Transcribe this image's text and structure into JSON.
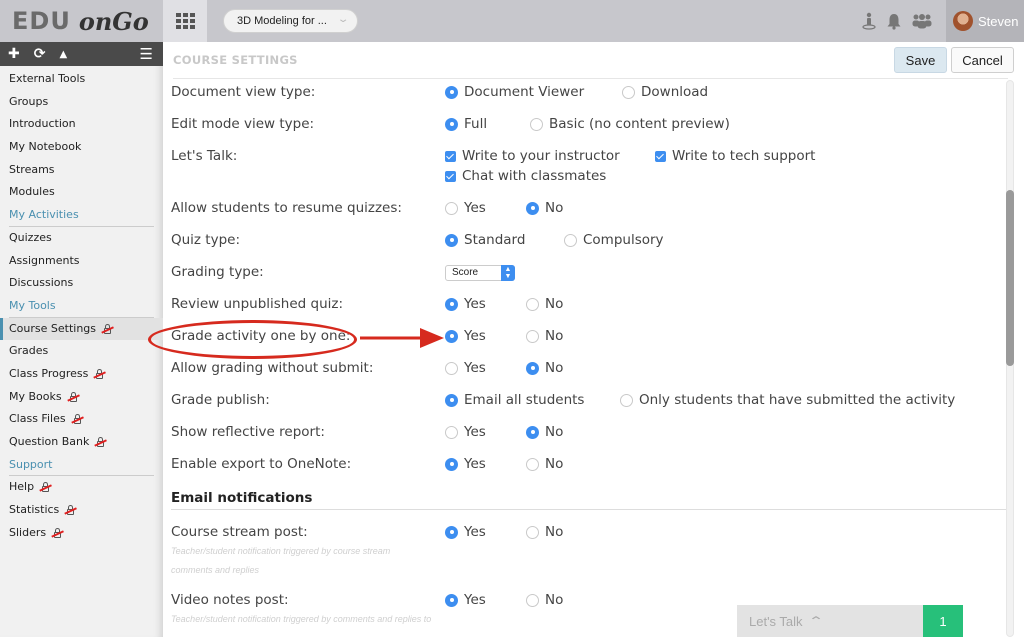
{
  "header": {
    "logo_part1": "EDU",
    "logo_part2": "onGo",
    "course_selector": "3D Modeling for ...",
    "user_name": "Steven",
    "icons": [
      "person-pin-icon",
      "bell-icon",
      "users-icon"
    ]
  },
  "sidebar": {
    "toolbar_icons": [
      "plus-icon",
      "refresh-icon",
      "sort-icon",
      "menu-icon"
    ],
    "items": [
      {
        "label": "External Tools",
        "type": "item",
        "locked": false
      },
      {
        "label": "Groups",
        "type": "item",
        "locked": false
      },
      {
        "label": "Introduction",
        "type": "item",
        "locked": false
      },
      {
        "label": "My Notebook",
        "type": "item",
        "locked": false
      },
      {
        "label": "Streams",
        "type": "item",
        "locked": false
      },
      {
        "label": "Modules",
        "type": "item",
        "locked": false
      },
      {
        "label": "My Activities",
        "type": "section",
        "locked": false
      },
      {
        "label": "Quizzes",
        "type": "item",
        "locked": false
      },
      {
        "label": "Assignments",
        "type": "item",
        "locked": false
      },
      {
        "label": "Discussions",
        "type": "item",
        "locked": false
      },
      {
        "label": "My Tools",
        "type": "section",
        "locked": false
      },
      {
        "label": "Course Settings",
        "type": "item",
        "locked": true,
        "active": true
      },
      {
        "label": "Grades",
        "type": "item",
        "locked": false
      },
      {
        "label": "Class Progress",
        "type": "item",
        "locked": true
      },
      {
        "label": "My Books",
        "type": "item",
        "locked": true
      },
      {
        "label": "Class Files",
        "type": "item",
        "locked": true
      },
      {
        "label": "Question Bank",
        "type": "item",
        "locked": true
      },
      {
        "label": "Support",
        "type": "section",
        "locked": false
      },
      {
        "label": "Help",
        "type": "item",
        "locked": true
      },
      {
        "label": "Statistics",
        "type": "item",
        "locked": true
      },
      {
        "label": "Sliders",
        "type": "item",
        "locked": true
      }
    ]
  },
  "main": {
    "title": "COURSE SETTINGS",
    "save_label": "Save",
    "cancel_label": "Cancel",
    "settings": [
      {
        "label": "Document view type:",
        "options": [
          "Document Viewer",
          "Download"
        ],
        "selected": "Document Viewer"
      },
      {
        "label": "Edit mode view type:",
        "options": [
          "Full",
          "Basic (no content preview)"
        ],
        "selected": "Full"
      },
      {
        "label": "Let's Talk:",
        "checkboxes": [
          "Write to your instructor",
          "Write to tech support",
          "Chat with classmates"
        ],
        "checked": [
          true,
          true,
          true
        ]
      },
      {
        "label": "Allow students to resume quizzes:",
        "options": [
          "Yes",
          "No"
        ],
        "selected": "No"
      },
      {
        "label": "Quiz type:",
        "options": [
          "Standard",
          "Compulsory"
        ],
        "selected": "Standard"
      },
      {
        "label": "Grading type:",
        "select_value": "Score"
      },
      {
        "label": "Review unpublished quiz:",
        "options": [
          "Yes",
          "No"
        ],
        "selected": "Yes"
      },
      {
        "label": "Grade activity one by one:",
        "options": [
          "Yes",
          "No"
        ],
        "selected": "Yes"
      },
      {
        "label": "Allow grading without submit:",
        "options": [
          "Yes",
          "No"
        ],
        "selected": "No"
      },
      {
        "label": "Grade publish:",
        "options": [
          "Email all students",
          "Only students that have submitted the activity"
        ],
        "selected": "Email all students"
      },
      {
        "label": "Show reflective report:",
        "options": [
          "Yes",
          "No"
        ],
        "selected": "No"
      },
      {
        "label": "Enable export to OneNote:",
        "options": [
          "Yes",
          "No"
        ],
        "selected": "Yes"
      }
    ],
    "email_section_title": "Email notifications",
    "email_settings": [
      {
        "label": "Course stream post:",
        "options": [
          "Yes",
          "No"
        ],
        "selected": "Yes",
        "hint_lines": [
          "Teacher/student notification triggered by course stream",
          "comments and replies"
        ]
      },
      {
        "label": "Video notes post:",
        "options": [
          "Yes",
          "No"
        ],
        "selected": "Yes",
        "hint_lines": [
          "Teacher/student notification triggered by comments and replies to"
        ]
      }
    ],
    "annotation_color": "#d62a1e",
    "accent_color": "#3d8ef0"
  },
  "letstalk": {
    "label": "Let's Talk",
    "count": "1",
    "count_color": "#27c07a"
  }
}
